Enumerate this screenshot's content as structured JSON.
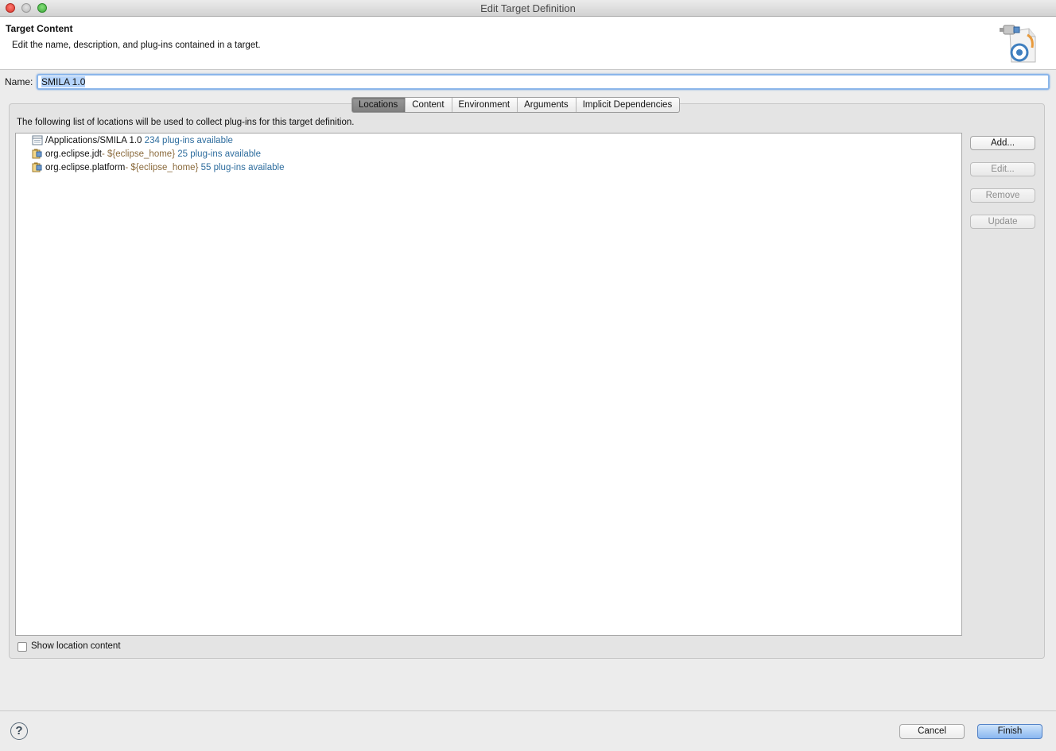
{
  "window": {
    "title": "Edit Target Definition"
  },
  "header": {
    "title": "Target Content",
    "description": "Edit the name, description, and plug-ins contained in a target.",
    "icon": "target-plugin-icon"
  },
  "name_field": {
    "label": "Name:",
    "value": "SMILA 1.0"
  },
  "tabs": [
    {
      "label": "Locations",
      "active": true
    },
    {
      "label": "Content",
      "active": false
    },
    {
      "label": "Environment",
      "active": false
    },
    {
      "label": "Arguments",
      "active": false
    },
    {
      "label": "Implicit Dependencies",
      "active": false
    }
  ],
  "locations": {
    "description": "The following list of locations will be used to collect plug-ins for this target definition.",
    "items": [
      {
        "name": "/Applications/SMILA 1.0",
        "meta": "",
        "count": "234 plug-ins available",
        "icon": "directory-location-icon"
      },
      {
        "name": "org.eclipse.jdt",
        "meta": " - ${eclipse_home}",
        "count": "25 plug-ins available",
        "icon": "feature-location-icon"
      },
      {
        "name": "org.eclipse.platform",
        "meta": " - ${eclipse_home}",
        "count": "55 plug-ins available",
        "icon": "feature-location-icon"
      }
    ],
    "buttons": {
      "add": "Add...",
      "edit": "Edit...",
      "remove": "Remove",
      "update": "Update"
    },
    "show_content_label": "Show location content",
    "show_content_checked": false
  },
  "footer": {
    "help_icon": "help-icon",
    "cancel": "Cancel",
    "finish": "Finish"
  },
  "colors": {
    "accent": "#8bb6ea",
    "meta_text": "#8b6b3d",
    "count_text": "#2e6d9e"
  }
}
